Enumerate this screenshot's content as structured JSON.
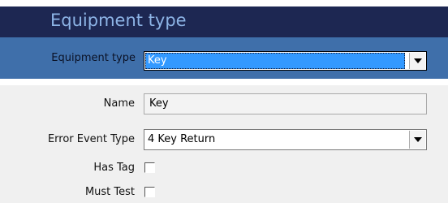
{
  "window": {
    "title": "Equipment type"
  },
  "header": {
    "equipment_type_label": "Equipment type",
    "equipment_type_value": "Key"
  },
  "form": {
    "name_label": "Name",
    "name_value": "Key",
    "error_event_type_label": "Error Event Type",
    "error_event_type_value": "4 Key Return",
    "has_tag_label": "Has Tag",
    "has_tag_checked": false,
    "must_test_label": "Must Test",
    "must_test_checked": false
  },
  "colors": {
    "title_bar": "#1d2752",
    "title_text": "#8db4e6",
    "header_band": "#3f6faa",
    "selection": "#3399ff",
    "form_background": "#f0f0f0"
  }
}
